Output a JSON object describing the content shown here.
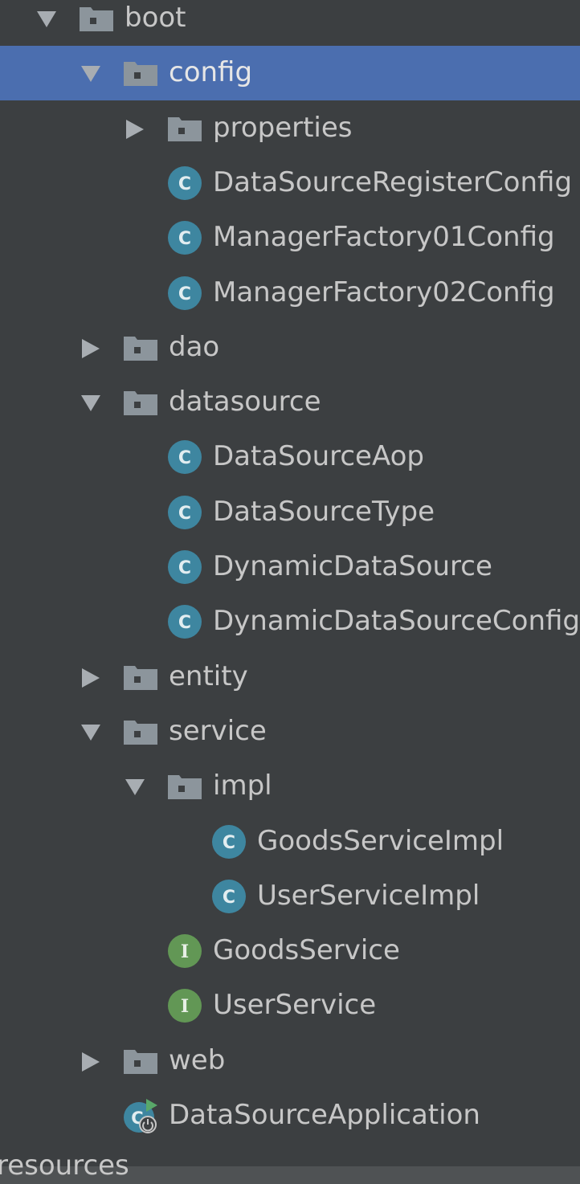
{
  "tree": {
    "items": [
      {
        "label": "boot",
        "kind": "folder",
        "expanded": true,
        "depth": 0,
        "icon": "folder-icon"
      },
      {
        "label": "config",
        "kind": "folder",
        "expanded": true,
        "depth": 1,
        "icon": "folder-icon",
        "selected": true
      },
      {
        "label": "properties",
        "kind": "folder",
        "expanded": false,
        "depth": 2,
        "icon": "folder-icon"
      },
      {
        "label": "DataSourceRegisterConfig",
        "kind": "class",
        "depth": 2,
        "icon": "class-icon"
      },
      {
        "label": "ManagerFactory01Config",
        "kind": "class",
        "depth": 2,
        "icon": "class-icon"
      },
      {
        "label": "ManagerFactory02Config",
        "kind": "class",
        "depth": 2,
        "icon": "class-icon"
      },
      {
        "label": "dao",
        "kind": "folder",
        "expanded": false,
        "depth": 1,
        "icon": "folder-icon"
      },
      {
        "label": "datasource",
        "kind": "folder",
        "expanded": true,
        "depth": 1,
        "icon": "folder-icon"
      },
      {
        "label": "DataSourceAop",
        "kind": "class",
        "depth": 2,
        "icon": "class-icon"
      },
      {
        "label": "DataSourceType",
        "kind": "class",
        "depth": 2,
        "icon": "class-icon"
      },
      {
        "label": "DynamicDataSource",
        "kind": "class",
        "depth": 2,
        "icon": "class-icon"
      },
      {
        "label": "DynamicDataSourceConfig",
        "kind": "class",
        "depth": 2,
        "icon": "class-icon"
      },
      {
        "label": "entity",
        "kind": "folder",
        "expanded": false,
        "depth": 1,
        "icon": "folder-icon"
      },
      {
        "label": "service",
        "kind": "folder",
        "expanded": true,
        "depth": 1,
        "icon": "folder-icon"
      },
      {
        "label": "impl",
        "kind": "folder",
        "expanded": true,
        "depth": 2,
        "icon": "folder-icon"
      },
      {
        "label": "GoodsServiceImpl",
        "kind": "class",
        "depth": 3,
        "icon": "class-icon"
      },
      {
        "label": "UserServiceImpl",
        "kind": "class",
        "depth": 3,
        "icon": "class-icon"
      },
      {
        "label": "GoodsService",
        "kind": "interface",
        "depth": 2,
        "icon": "interface-icon"
      },
      {
        "label": "UserService",
        "kind": "interface",
        "depth": 2,
        "icon": "interface-icon"
      },
      {
        "label": "web",
        "kind": "folder",
        "expanded": false,
        "depth": 1,
        "icon": "folder-icon"
      },
      {
        "label": "DataSourceApplication",
        "kind": "spring-boot-app",
        "depth": 1,
        "icon": "spring-boot-app-icon"
      }
    ]
  },
  "footer": {
    "resources_label": "resources"
  },
  "colors": {
    "background": "#3c3f41",
    "selection": "#4b6eaf",
    "folder": "#8c959c",
    "class": "#3e86a0",
    "interface": "#629755",
    "text": "#c7c7c7",
    "arrow": "#a8adb2"
  }
}
